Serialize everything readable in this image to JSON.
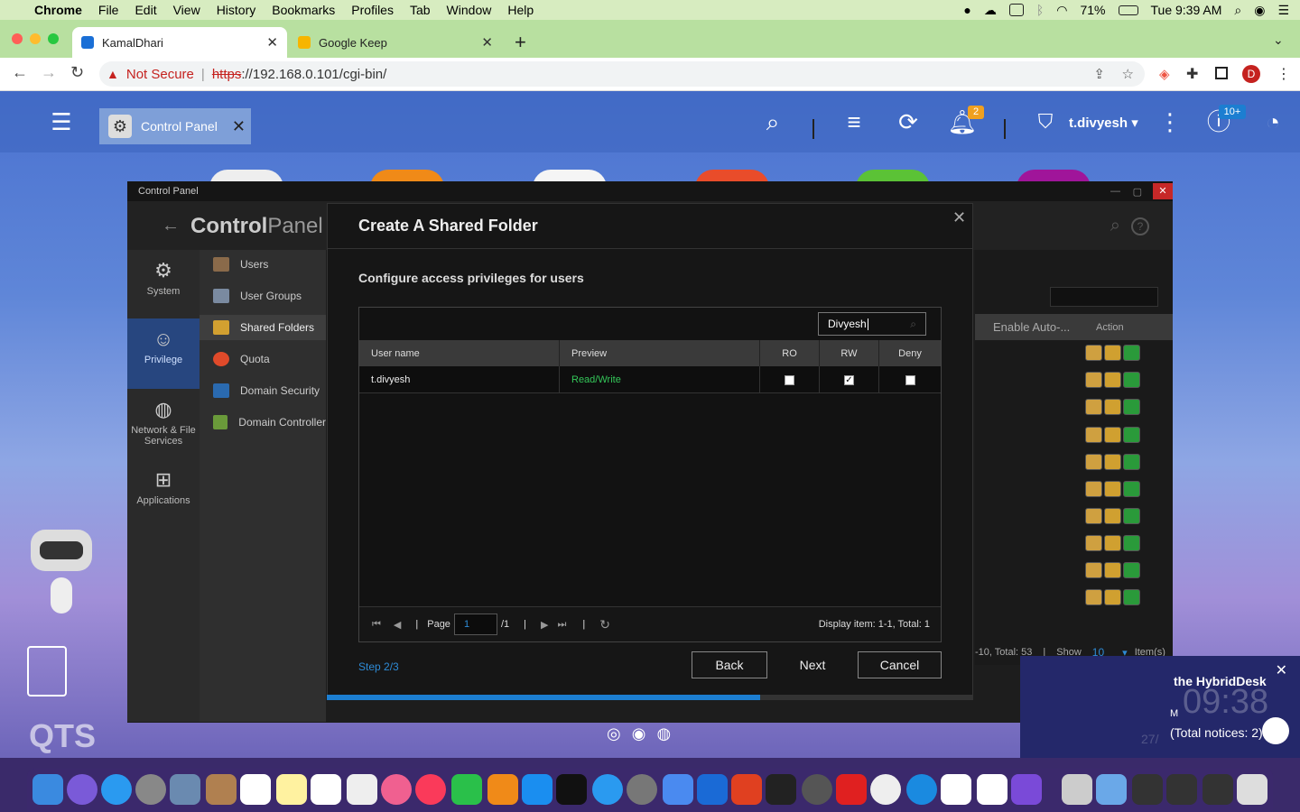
{
  "menubar": {
    "apple": "",
    "app": "Chrome",
    "items": [
      "File",
      "Edit",
      "View",
      "History",
      "Bookmarks",
      "Profiles",
      "Tab",
      "Window",
      "Help"
    ],
    "battery": "71%",
    "clock": "Tue 9:39 AM"
  },
  "tabs": [
    {
      "label": "KamalDhari",
      "icon": "qnap-icon",
      "active": true
    },
    {
      "label": "Google Keep",
      "icon": "keep-icon",
      "active": false
    }
  ],
  "browser": {
    "security": "Not Secure",
    "url_scheme": "https",
    "url_rest": "://192.168.0.101/cgi-bin/",
    "profile_initial": "D"
  },
  "qts": {
    "tab_label": "Control Panel",
    "notification_count": "2",
    "user": "t.divyesh",
    "updates_badge": "10+",
    "brand": "QTS"
  },
  "control_panel": {
    "window_title": "Control Panel",
    "heading_bold": "Control",
    "heading_light": "Panel",
    "categories": [
      {
        "label": "System",
        "icon": "gear-icon"
      },
      {
        "label": "Privilege",
        "icon": "user-icon"
      },
      {
        "label": "Network & File Services",
        "icon": "globe-icon"
      },
      {
        "label": "Applications",
        "icon": "apps-grid-icon"
      }
    ],
    "sub_items": [
      "Users",
      "User Groups",
      "Shared Folders",
      "Quota",
      "Domain Security",
      "Domain Controller"
    ],
    "table_headers": [
      "Enable Auto-...",
      "Action"
    ],
    "footer": {
      "display": "-10, Total: 53",
      "show_label": "Show",
      "show_value": "10",
      "items_label": "Item(s)"
    }
  },
  "dialog": {
    "title": "Create A Shared Folder",
    "subtitle": "Configure access privileges for users",
    "search_value": "Divyesh",
    "columns": [
      "User name",
      "Preview",
      "RO",
      "RW",
      "Deny"
    ],
    "rows": [
      {
        "user": "t.divyesh",
        "preview": "Read/Write",
        "ro": false,
        "rw": true,
        "deny": false
      }
    ],
    "pager": {
      "page_label": "Page",
      "page_value": "1",
      "page_total": "/1",
      "display": "Display item: 1-1, Total: 1"
    },
    "step": "Step 2/3",
    "progress": 0.67,
    "buttons": {
      "back": "Back",
      "next": "Next",
      "cancel": "Cancel"
    }
  },
  "notification": {
    "title": "the HybridDesk",
    "time": "09:38",
    "suffix": "M",
    "notices": "(Total notices: 2)",
    "date": "27/"
  },
  "colors": {
    "accent": "#1c7ed1",
    "read_write": "#34c759",
    "selected_category": "#27467f"
  }
}
